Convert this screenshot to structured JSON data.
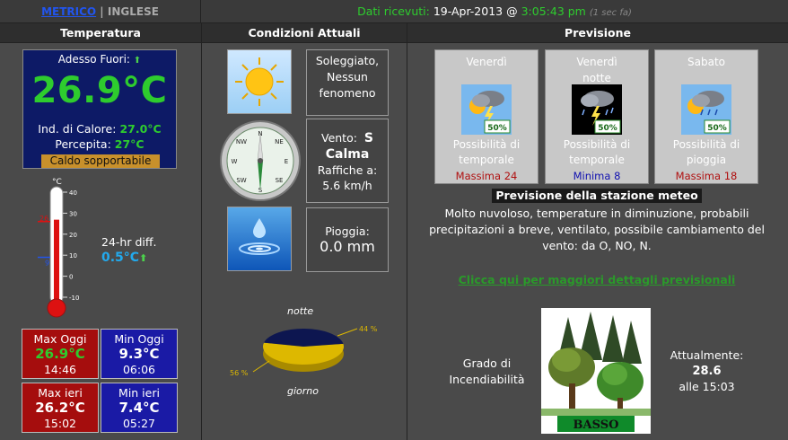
{
  "units": {
    "metric": "METRICO",
    "separator": "|",
    "english": "INGLESE"
  },
  "received": {
    "label": "Dati ricevuti:",
    "date": "19-Apr-2013 @",
    "time": "3:05:43 pm",
    "ago": "(1 sec fa)"
  },
  "headers": {
    "temperature": "Temperatura",
    "conditions": "Condizioni Attuali",
    "forecast": "Previsione"
  },
  "current": {
    "label": "Adesso Fuori:",
    "trend_arrow": "⬆",
    "temp": "26.9°C",
    "heat_label": "Ind. di Calore:",
    "heat_value": "27.0°C",
    "feel_label": "Percepita:",
    "feel_value": "27°C",
    "status": "Caldo sopportabile"
  },
  "thermometer": {
    "unit": "°C",
    "ticks": [
      "40",
      "30",
      "20",
      "10",
      "0",
      "-10"
    ],
    "max_marker": "26",
    "min_marker": "9",
    "level_c": 26.9
  },
  "diff": {
    "label": "24-hr diff.",
    "value": "0.5°C",
    "arrow": "⬆"
  },
  "minmax": {
    "max_today": {
      "title": "Max Oggi",
      "value": "26.9°C",
      "time": "14:46"
    },
    "min_today": {
      "title": "Min Oggi",
      "value": "9.3°C",
      "time": "06:06"
    },
    "max_yest": {
      "title": "Max ieri",
      "value": "26.2°C",
      "time": "15:02"
    },
    "min_yest": {
      "title": "Min ieri",
      "value": "7.4°C",
      "time": "05:27"
    }
  },
  "conditions": {
    "icon": "sun-icon",
    "line1": "Soleggiato,",
    "line2": "Nessun",
    "line3": "fenomeno",
    "wind_label": "Vento:",
    "wind_dir": "S",
    "wind_calm": "Calma",
    "gust_label": "Raffiche a:",
    "gust_value": "5.6 km/h",
    "rain_label": "Pioggia:",
    "rain_value": "0.0 mm",
    "compass": {
      "n": "N",
      "ne": "NE",
      "e": "E",
      "se": "SE",
      "s": "S",
      "sw": "SW",
      "w": "W",
      "nw": "NW"
    }
  },
  "daynight": {
    "night_label": "notte",
    "day_label": "giorno",
    "night_pct": "44 %",
    "day_pct": "56 %",
    "night_value": 44,
    "day_value": 56
  },
  "forecast": [
    {
      "day": "Venerdì",
      "day2": "",
      "desc1": "Possibilità di",
      "desc2": "temporale",
      "prob": "50%",
      "temp": "Massima 24",
      "kind": "max",
      "icon": "storm-day-icon"
    },
    {
      "day": "Venerdì",
      "day2": "notte",
      "desc1": "Possibilità di",
      "desc2": "temporale",
      "prob": "50%",
      "temp": "Minima 8",
      "kind": "min",
      "icon": "storm-night-icon"
    },
    {
      "day": "Sabato",
      "day2": "",
      "desc1": "Possibilità di pioggia",
      "desc2": "",
      "prob": "50%",
      "temp": "Massima 18",
      "kind": "max",
      "icon": "rain-day-icon"
    }
  ],
  "station": {
    "title": "Previsione della stazione meteo",
    "text": "Molto nuvoloso, temperature in diminuzione, probabili precipitazioni a breve, ventilato, possibile cambiamento del vento: da O, NO, N.",
    "link": "Clicca qui per maggiori dettagli previsionali"
  },
  "fire": {
    "label1": "Grado di",
    "label2": "Incendiabilità",
    "level": "BASSO",
    "now_label": "Attualmente:",
    "now_value": "28.6",
    "now_time": "alle 15:03"
  },
  "colors": {
    "green": "#2ecc2e",
    "blue_box": "#1a1aa5",
    "red_box": "#a50d0d",
    "navy": "#0d1a66"
  }
}
